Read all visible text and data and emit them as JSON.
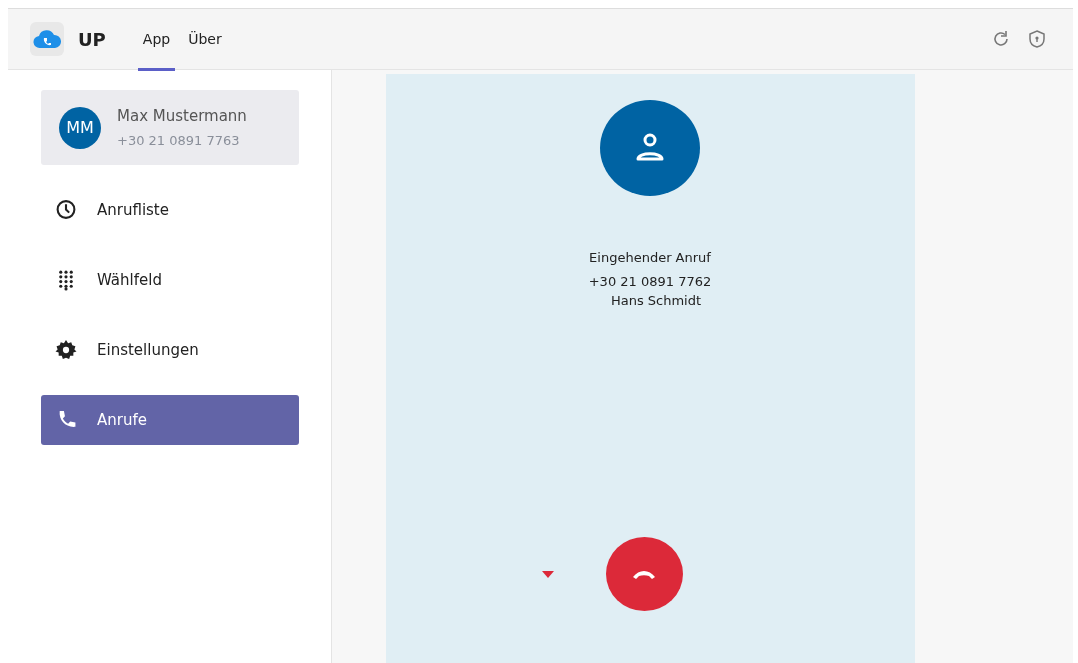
{
  "app": {
    "name": "UP"
  },
  "tabs": [
    {
      "label": "App",
      "selected": true
    },
    {
      "label": "Über",
      "selected": false
    }
  ],
  "user": {
    "initials": "MM",
    "name": "Max Mustermann",
    "phone": "+30 21 0891 7763"
  },
  "sidebar": {
    "items": [
      {
        "kind": "clock",
        "label": "Anrufliste",
        "selected": false
      },
      {
        "kind": "dialpad",
        "label": "Wählfeld",
        "selected": false
      },
      {
        "kind": "gear",
        "label": "Einstellungen",
        "selected": false
      },
      {
        "kind": "phone",
        "label": "Anrufe",
        "selected": true
      }
    ]
  },
  "call": {
    "status": "Eingehender Anruf",
    "number": "+30 21 0891 7762",
    "name": "Hans Schmidt"
  }
}
